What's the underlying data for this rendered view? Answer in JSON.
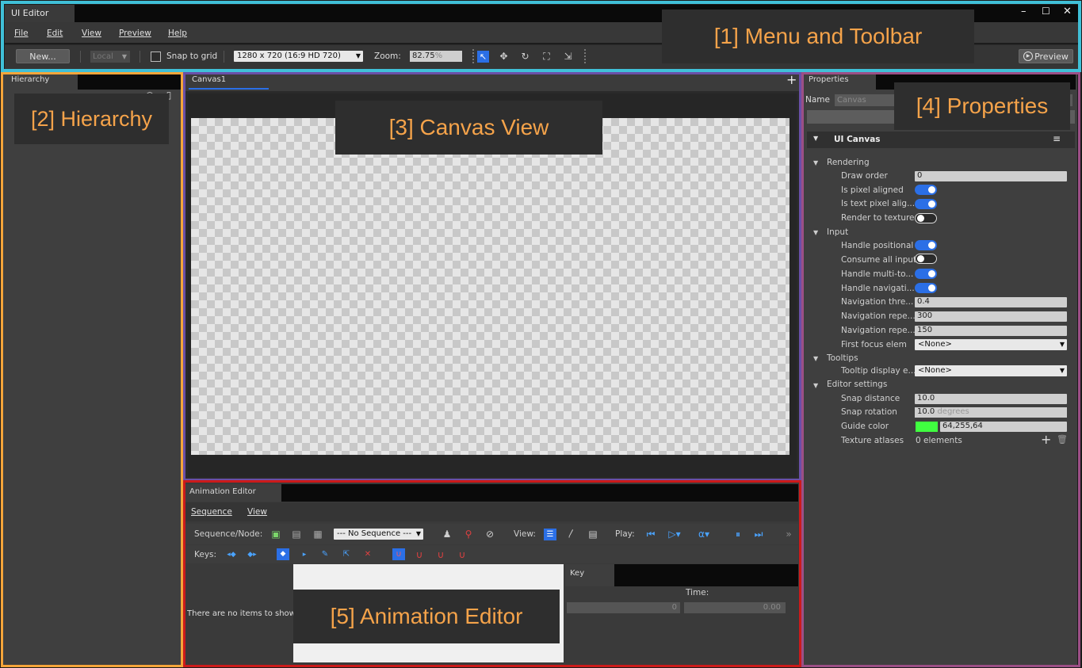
{
  "window": {
    "title": "UI Editor",
    "minimize": "–",
    "maximize": "☐",
    "close": "✕"
  },
  "menu": [
    "File",
    "Edit",
    "View",
    "Preview",
    "Help"
  ],
  "toolbar": {
    "new_label": "New...",
    "space_label": "Local",
    "snap_label": "Snap to grid",
    "resolution": "1280 x 720 (16:9 HD 720)",
    "zoom_label": "Zoom:",
    "zoom_value": "82.75",
    "zoom_suffix": "%",
    "preview_label": "Preview"
  },
  "hierarchy": {
    "tab": "Hierarchy"
  },
  "canvas": {
    "tab": "Canvas1",
    "add": "+"
  },
  "properties": {
    "tab": "Properties",
    "name_label": "Name",
    "name_value": "Canvas",
    "component": "UI Canvas",
    "sections": {
      "rendering": "Rendering",
      "input": "Input",
      "tooltips": "Tooltips",
      "editor": "Editor settings"
    },
    "draw_order": {
      "label": "Draw order",
      "value": "0"
    },
    "pixel_aligned": {
      "label": "Is pixel aligned",
      "on": true
    },
    "text_pixel_aligned": {
      "label": "Is text pixel alig...",
      "on": true
    },
    "render_to_texture": {
      "label": "Render to texture",
      "on": false
    },
    "handle_positional": {
      "label": "Handle positional",
      "on": true
    },
    "consume_all": {
      "label": "Consume all input",
      "on": false
    },
    "handle_multi": {
      "label": "Handle multi-to...",
      "on": true
    },
    "handle_nav": {
      "label": "Handle navigati...",
      "on": true
    },
    "nav_threshold": {
      "label": "Navigation thre...",
      "value": "0.4"
    },
    "nav_repeat1": {
      "label": "Navigation repe...",
      "value": "300"
    },
    "nav_repeat2": {
      "label": "Navigation repe...",
      "value": "150"
    },
    "first_focus": {
      "label": "First focus elem",
      "value": "<None>"
    },
    "tooltip_display": {
      "label": "Tooltip display e...",
      "value": "<None>"
    },
    "snap_distance": {
      "label": "Snap distance",
      "value": "10.0"
    },
    "snap_rotation": {
      "label": "Snap rotation",
      "value": "10.0",
      "unit": "degrees"
    },
    "guide_color": {
      "label": "Guide color",
      "value": "64,255,64",
      "swatch": "#40ff40"
    },
    "texture_atlases": {
      "label": "Texture atlases",
      "value": "0 elements"
    }
  },
  "animation": {
    "tab": "Animation Editor",
    "menu": [
      "Sequence",
      "View"
    ],
    "seq_label": "Sequence/Node:",
    "seq_value": "--- No Sequence ---",
    "view_label": "View:",
    "play_label": "Play:",
    "keys_label": "Keys:",
    "empty_text": "There are no items to show",
    "key_tab": "Key",
    "time_label": "Time:",
    "frame_value": "0",
    "time_value": "0.00"
  },
  "callouts": {
    "c1": "[1] Menu and Toolbar",
    "c2": "[2] Hierarchy",
    "c3": "[3] Canvas View",
    "c4": "[4] Properties",
    "c5": "[5] Animation Editor"
  },
  "colors": {
    "menu_frame": "#40c0d8",
    "hierarchy_frame": "#f5a53a",
    "canvas_frame": "#6a4fa8",
    "properties_frame": "#9c4f86",
    "animation_frame": "#cc1a1a",
    "accent": "#2b6fe6",
    "callout_text": "#f5a34a"
  }
}
